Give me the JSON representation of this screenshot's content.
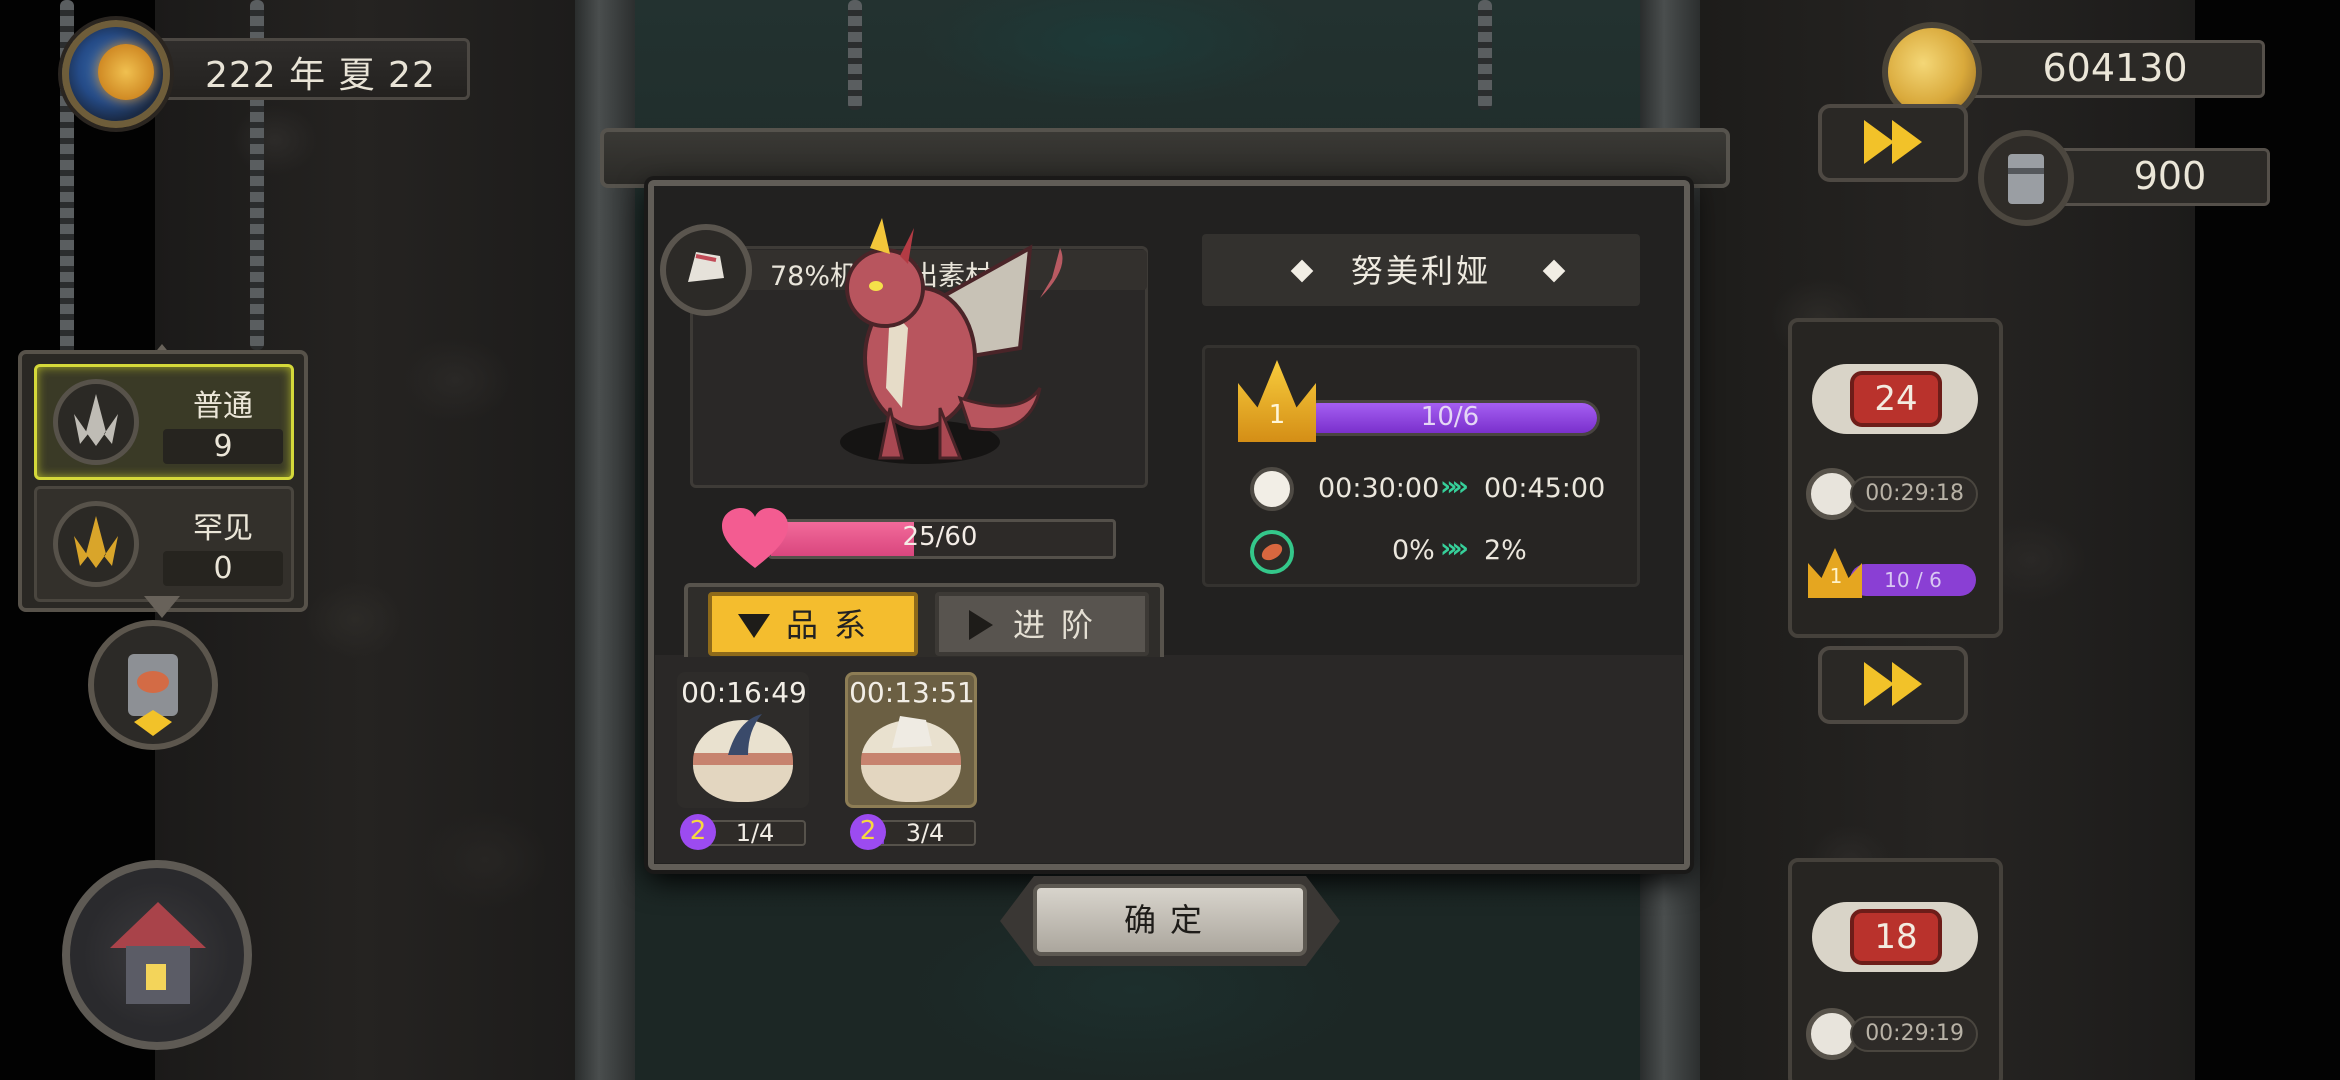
{
  "hud": {
    "date": "222 年 夏 22",
    "gold": "604130",
    "barrels": "900",
    "season_icon": "sun-season-icon",
    "gold_icon": "gold-coin-icon",
    "barrel_icon": "barrel-icon"
  },
  "rarity_panel": {
    "items": [
      {
        "name": "普通",
        "count": "9",
        "selected": true
      },
      {
        "name": "罕见",
        "count": "0",
        "selected": false
      }
    ]
  },
  "side_cards": [
    {
      "bone_number": "24",
      "timer": "00:29:18",
      "level": "1",
      "progress": "10 / 6"
    },
    {
      "bone_number": "18",
      "timer": "00:29:19"
    }
  ],
  "dialog": {
    "bonus_text": "78%机率产出素材",
    "dragon_name": "努美利娅",
    "affection": {
      "text": "25/60",
      "value": 25,
      "max": 60
    },
    "level": {
      "crown": "1",
      "progress_text": "10/6",
      "value": 10,
      "max": 6
    },
    "stats": {
      "time_current": "00:30:00",
      "time_next": "00:45:00",
      "rate_current": "0%",
      "rate_next": "2%"
    },
    "tabs": [
      {
        "label": "品系",
        "active": true
      },
      {
        "label": "进阶",
        "active": false
      }
    ],
    "eggs": [
      {
        "timer": "00:16:49",
        "level": "2",
        "progress": "1/4",
        "fill": 0.25
      },
      {
        "timer": "00:13:51",
        "level": "2",
        "progress": "3/4",
        "fill": 0.75
      }
    ],
    "confirm_label": "确定"
  },
  "colors": {
    "accent_gold": "#f4bd2e",
    "level_purple": "#8a3fd4",
    "affection_pink": "#e85288",
    "arrow_green": "#36d09a"
  }
}
